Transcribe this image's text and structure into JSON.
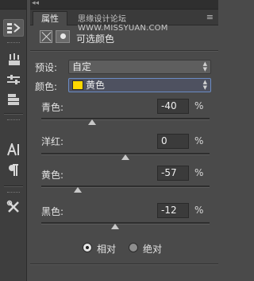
{
  "watermark": "思缘设计论坛 WWW.MISSYUAN.COM",
  "tab": {
    "label": "属性"
  },
  "panel": {
    "title": "可选颜色",
    "preset": {
      "label": "预设:",
      "value": "自定"
    },
    "colors": {
      "label": "颜色:",
      "value": "黄色",
      "swatch_color": "#ffd800"
    },
    "sliders": [
      {
        "label": "青色:",
        "value": "-40",
        "unit": "%",
        "level_percent": -40
      },
      {
        "label": "洋红:",
        "value": "0",
        "unit": "%",
        "level_percent": 0
      },
      {
        "label": "黄色:",
        "value": "-57",
        "unit": "%",
        "level_percent": -57
      },
      {
        "label": "黑色:",
        "value": "-12",
        "unit": "%",
        "level_percent": -12
      }
    ],
    "method": {
      "options": [
        "相对",
        "绝对"
      ],
      "selected": "相对"
    }
  },
  "icons": {
    "toolbar": [
      "properties-icon",
      "brush-presets-icon",
      "adjustments-icon",
      "layer-comps-icon",
      "character-icon",
      "paragraph-icon",
      "tools-icon"
    ]
  }
}
